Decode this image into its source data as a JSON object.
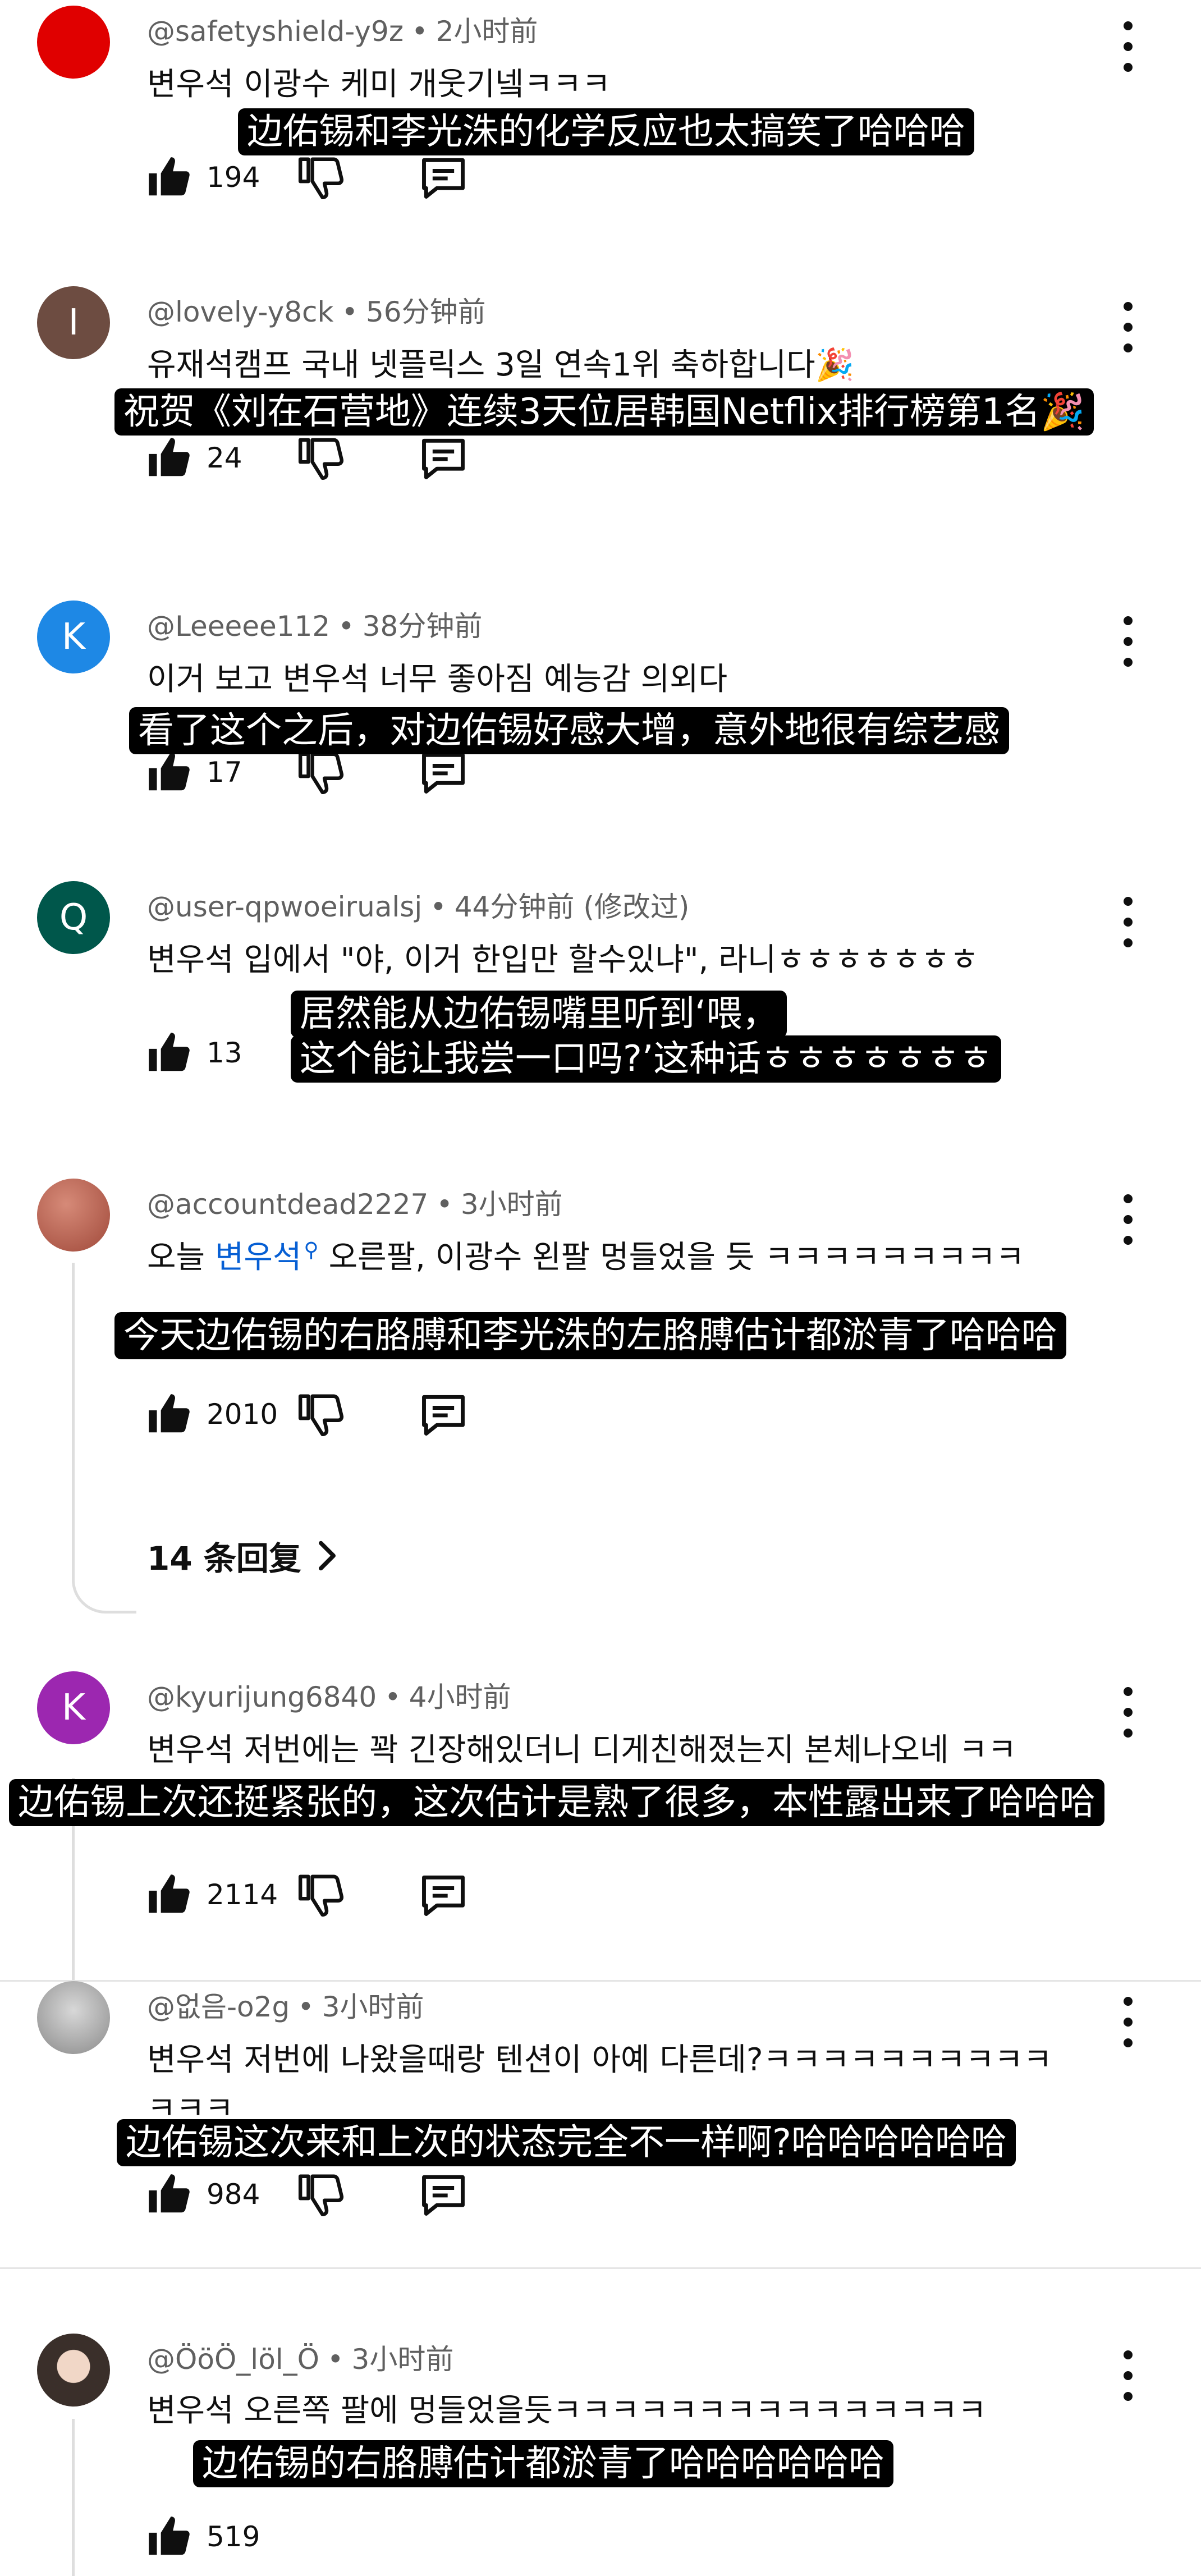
{
  "comments": [
    {
      "handle": "@safetyshield-y9z",
      "time": "2小时前",
      "text": "변우석 이광수 케미 개웃기넼ㅋㅋㅋ",
      "subtitle": "边佑锡和李光洙的化学反应也太搞笑了哈哈哈",
      "likes": "194",
      "avatar_color": "#e00000"
    },
    {
      "handle": "@lovely-y8ck",
      "time": "56分钟前",
      "avatar_letter": "I",
      "text": "유재석캠프 국내 넷플릭스 3일 연속1위 축하합니다🎉",
      "subtitle": "祝贺《刘在石营地》连续3天位居韩国Netflix排行榜第1名🎉",
      "likes": "24",
      "avatar_color": "#6d4c41"
    },
    {
      "handle": "@Leeeee112",
      "time": "38分钟前",
      "avatar_letter": "K",
      "text": "이거 보고 변우석 너무 좋아짐 예능감 의외다",
      "subtitle": "看了这个之后，对边佑锡好感大增，意外地很有综艺感",
      "likes": "17",
      "avatar_color": "#1e88e5"
    },
    {
      "handle": "@user-qpwoeirualsj",
      "time": "44分钟前",
      "edited": "(修改过)",
      "avatar_letter": "Q",
      "text": "변우석 입에서 \"야, 이거 한입만 할수있냐\", 라니ㅎㅎㅎㅎㅎㅎㅎ",
      "subtitle_line1": "居然能从边佑锡嘴里听到‘喂，",
      "subtitle_line2": "这个能让我尝一口吗?’这种话ㅎㅎㅎㅎㅎㅎㅎ",
      "likes": "13",
      "avatar_color": "#00574b"
    },
    {
      "handle": "@accountdead2227",
      "time": "3小时前",
      "text_pre": "오늘 ",
      "text_link": "변우석",
      "text_post": " 오른팔, 이광수 왼팔 멍들었을 듯 ㅋㅋㅋㅋㅋㅋㅋㅋㅋ",
      "subtitle": "今天边佑锡的右胳膊和李光洙的左胳膊估计都淤青了哈哈哈",
      "likes": "2010",
      "replies": "14 条回复",
      "avatar_color": "#b5604f"
    },
    {
      "handle": "@kyurijung6840",
      "time": "4小时前",
      "avatar_letter": "K",
      "text": "변우석 저번에는 꽉 긴장해있더니 디게친해졌는지 본체나오네 ㅋㅋ",
      "subtitle": "边佑锡上次还挺紧张的，这次估计是熟了很多，本性露出来了哈哈哈",
      "likes": "2114",
      "avatar_color": "#9c27b0"
    },
    {
      "handle": "@없음-o2g",
      "time": "3小时前",
      "text_line1": "변우석 저번에 나왔을때랑 텐션이 아예 다른데?ㅋㅋㅋㅋㅋㅋㅋㅋㅋㅋ",
      "text_line2": "ㅋㅋㅋ",
      "subtitle": "边佑锡这次来和上次的状态完全不一样啊?哈哈哈哈哈哈",
      "likes": "984",
      "avatar_color": "#9e9e9e"
    },
    {
      "handle": "@ÖöÖ_löl_Ö",
      "time": "3小时前",
      "text": "변우석 오른쪽 팔에 멍들었을듯ㅋㅋㅋㅋㅋㅋㅋㅋㅋㅋㅋㅋㅋㅋㅋ",
      "subtitle": "边佑锡的右胳膊估计都淤青了哈哈哈哈哈哈",
      "likes": "519",
      "avatar_color": "#3a2f2a"
    }
  ]
}
